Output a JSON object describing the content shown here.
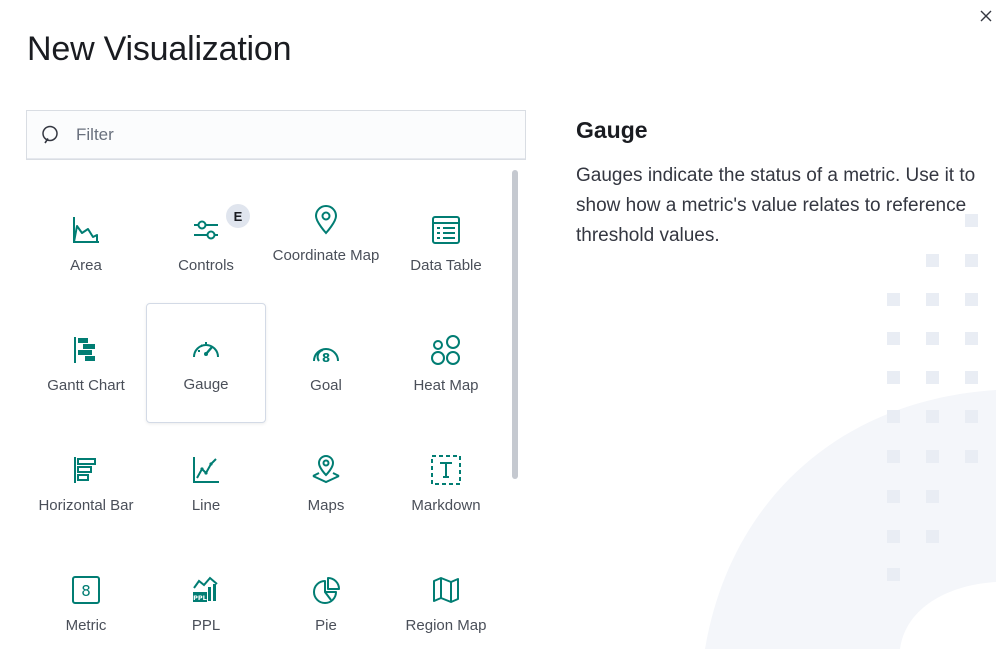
{
  "modal": {
    "title": "New Visualization",
    "close_icon": "close-icon"
  },
  "search": {
    "placeholder": "Filter",
    "value": "",
    "icon": "search-icon"
  },
  "visualizations": [
    {
      "label": "Area",
      "icon": "area-chart-icon"
    },
    {
      "label": "Controls",
      "icon": "controls-icon",
      "badge": "E"
    },
    {
      "label": "Coordinate Map",
      "icon": "map-marker-icon"
    },
    {
      "label": "Data Table",
      "icon": "data-table-icon"
    },
    {
      "label": "Gantt Chart",
      "icon": "gantt-chart-icon"
    },
    {
      "label": "Gauge",
      "icon": "gauge-icon",
      "selected": true
    },
    {
      "label": "Goal",
      "icon": "goal-icon"
    },
    {
      "label": "Heat Map",
      "icon": "heat-map-icon"
    },
    {
      "label": "Horizontal Bar",
      "icon": "horizontal-bar-icon"
    },
    {
      "label": "Line",
      "icon": "line-chart-icon"
    },
    {
      "label": "Maps",
      "icon": "maps-icon"
    },
    {
      "label": "Markdown",
      "icon": "markdown-icon"
    },
    {
      "label": "Metric",
      "icon": "metric-icon"
    },
    {
      "label": "PPL",
      "icon": "ppl-icon"
    },
    {
      "label": "Pie",
      "icon": "pie-chart-icon"
    },
    {
      "label": "Region Map",
      "icon": "region-map-icon"
    }
  ],
  "description": {
    "title": "Gauge",
    "text": "Gauges indicate the status of a metric. Use it to show how a metric's value relates to reference threshold values."
  },
  "colors": {
    "icon": "#017d73",
    "text": "#343741",
    "selected_border": "#d3dae6",
    "decoration": "#f1f4fa"
  }
}
